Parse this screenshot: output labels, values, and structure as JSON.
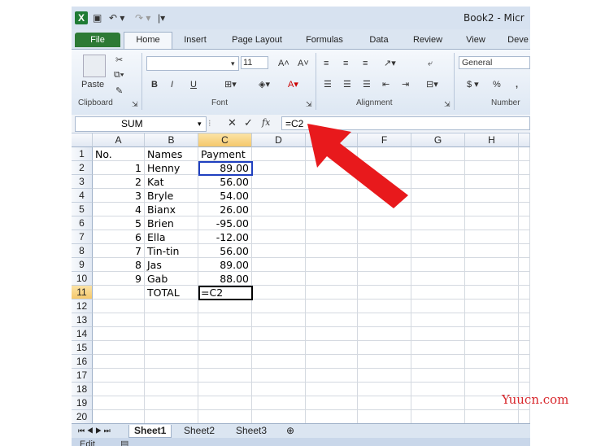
{
  "window": {
    "title": "Book2 - Micr"
  },
  "tabs": [
    "File",
    "Home",
    "Insert",
    "Page Layout",
    "Formulas",
    "Data",
    "Review",
    "View",
    "Deve"
  ],
  "ribbon": {
    "clipboard": {
      "paste": "Paste",
      "label": "Clipboard"
    },
    "font": {
      "size": "11",
      "bold": "B",
      "italic": "I",
      "underline": "U",
      "label": "Font",
      "font_color": "A"
    },
    "alignment": {
      "label": "Alignment"
    },
    "number": {
      "format": "General",
      "currency": "$",
      "percent": "%",
      "comma": ",",
      "label": "Number"
    }
  },
  "formula_bar": {
    "name_box": "SUM",
    "cancel": "✕",
    "enter": "✓",
    "fx": "fx",
    "content": "=C2"
  },
  "columns": [
    "A",
    "B",
    "C",
    "D",
    "E",
    "F",
    "G",
    "H"
  ],
  "rows": [
    {
      "n": "1",
      "a": "No.",
      "b": "Names",
      "c": "Payment"
    },
    {
      "n": "2",
      "a": "1",
      "b": "Henny",
      "c": "89.00"
    },
    {
      "n": "3",
      "a": "2",
      "b": "Kat",
      "c": "56.00"
    },
    {
      "n": "4",
      "a": "3",
      "b": "Bryle",
      "c": "54.00"
    },
    {
      "n": "5",
      "a": "4",
      "b": "Bianx",
      "c": "26.00"
    },
    {
      "n": "6",
      "a": "5",
      "b": "Brien",
      "c": "-95.00"
    },
    {
      "n": "7",
      "a": "6",
      "b": "Ella",
      "c": "-12.00"
    },
    {
      "n": "8",
      "a": "7",
      "b": "Tin-tin",
      "c": "56.00"
    },
    {
      "n": "9",
      "a": "8",
      "b": "Jas",
      "c": "89.00"
    },
    {
      "n": "10",
      "a": "9",
      "b": "Gab",
      "c": "88.00"
    },
    {
      "n": "11",
      "a": "",
      "b": "TOTAL",
      "c": "=C2"
    },
    {
      "n": "12",
      "a": "",
      "b": "",
      "c": ""
    },
    {
      "n": "13",
      "a": "",
      "b": "",
      "c": ""
    },
    {
      "n": "14",
      "a": "",
      "b": "",
      "c": ""
    },
    {
      "n": "15",
      "a": "",
      "b": "",
      "c": ""
    },
    {
      "n": "16",
      "a": "",
      "b": "",
      "c": ""
    },
    {
      "n": "17",
      "a": "",
      "b": "",
      "c": ""
    },
    {
      "n": "18",
      "a": "",
      "b": "",
      "c": ""
    },
    {
      "n": "19",
      "a": "",
      "b": "",
      "c": ""
    },
    {
      "n": "20",
      "a": "",
      "b": "",
      "c": ""
    }
  ],
  "sheets": [
    "Sheet1",
    "Sheet2",
    "Sheet3"
  ],
  "status": {
    "mode": "Edit"
  },
  "watermark": "Yuucn.com",
  "colors": {
    "file_tab": "#2d7a35",
    "arrow": "#e8191c",
    "active_border": "#1f3fbf"
  }
}
